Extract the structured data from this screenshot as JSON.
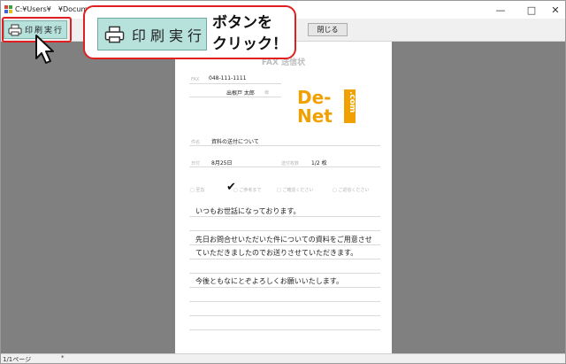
{
  "window": {
    "title": "C:¥Users¥　¥Documents¥",
    "minimize_glyph": "—",
    "maximize_glyph": "□",
    "close_glyph": "✕"
  },
  "toolbar": {
    "print_label": "印刷実行",
    "close_label": "閉じる"
  },
  "callout": {
    "button_label": "印刷実行",
    "text_line1": "ボタンを",
    "text_line2": "クリック！",
    "border_color": "#e02020"
  },
  "fax": {
    "title": "FAX 送信状",
    "fax_label": "FAX",
    "fax_number": "048-111-1111",
    "recipient": "出根戸 太郎",
    "honorific": "様",
    "subject_label": "件名",
    "subject": "資料の送付について",
    "date_label": "日付",
    "date": "8月25日",
    "pages_label": "送付枚数",
    "pages": "1/2 枚",
    "check_urgent": "至急",
    "check_reference": "ご参考まで",
    "check_confirm": "ご確認ください",
    "check_reply": "ご返信ください",
    "checkmark": "✔",
    "body_line1": "いつもお世話になっております。",
    "body_line2": "先日お問合せいただいた件についての資料をご用意させ",
    "body_line3": "ていただきましたのでお送りさせていただきます。",
    "body_line4": "今後ともなにとぞよろしくお願いいたします。"
  },
  "logo": {
    "line1": "De-",
    "line2": "Net",
    "suffix": ".com",
    "color": "#f0a000"
  },
  "status": {
    "page": "1/1ページ",
    "mark": "*"
  },
  "icons": [
    "printer-icon",
    "app-icon",
    "mouse-cursor-icon",
    "checkmark-icon"
  ]
}
